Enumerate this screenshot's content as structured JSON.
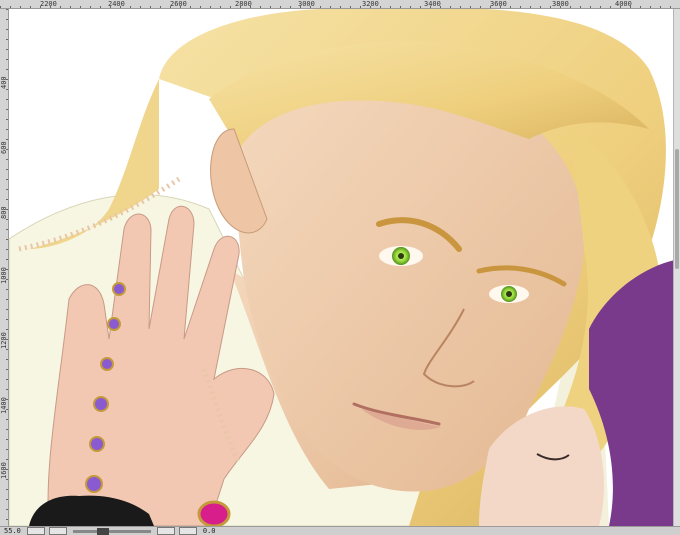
{
  "rulers": {
    "top_labels": [
      "2200",
      "2400",
      "2600",
      "2800",
      "3000",
      "3200",
      "3400",
      "3600",
      "3800",
      "4000"
    ],
    "left_labels": [
      "400",
      "600",
      "800",
      "1000",
      "1200",
      "1400",
      "1600"
    ]
  },
  "statusbar": {
    "zoom": "55.0",
    "value_right": "0.0"
  },
  "artwork": {
    "description_icon": "digital-painting-icon",
    "colors": {
      "hair": "#f3d98f",
      "skin": "#f2d2b5",
      "eyes": "#9be04a",
      "shirt": "#f7f6e2",
      "purple_hair": "#7a3a8c",
      "lace": "#1a1a1a",
      "amethyst": "#8a5bd0",
      "gem": "#d81e8a"
    }
  }
}
